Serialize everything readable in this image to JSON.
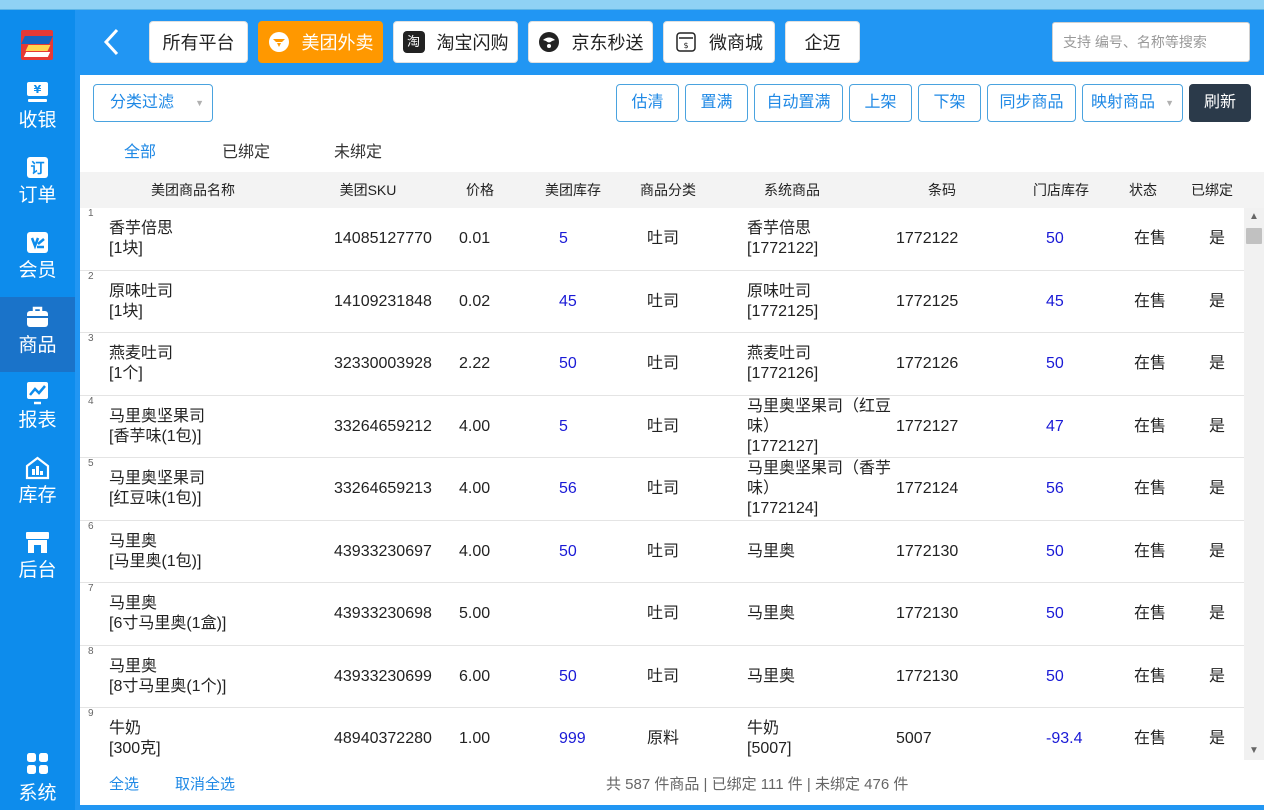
{
  "sidebar": {
    "logo_icon": "brand-logo-icon",
    "items": [
      {
        "label": "收银",
        "icon": "yen-register-icon",
        "active": false
      },
      {
        "label": "订单",
        "icon": "order-icon",
        "active": false
      },
      {
        "label": "会员",
        "icon": "member-card-icon",
        "active": false
      },
      {
        "label": "商品",
        "icon": "briefcase-icon",
        "active": true
      },
      {
        "label": "报表",
        "icon": "chart-icon",
        "active": false
      },
      {
        "label": "库存",
        "icon": "warehouse-icon",
        "active": false
      },
      {
        "label": "后台",
        "icon": "store-icon",
        "active": false
      }
    ],
    "system_label": "系统"
  },
  "header": {
    "platforms": [
      {
        "label": "所有平台",
        "active": false
      },
      {
        "label": "美团外卖",
        "active": true,
        "icon": "meituan-icon"
      },
      {
        "label": "淘宝闪购",
        "active": false,
        "icon": "taobao-icon",
        "icon_text": "淘"
      },
      {
        "label": "京东秒送",
        "active": false,
        "icon": "jd-icon"
      },
      {
        "label": "微商城",
        "active": false,
        "icon": "weishop-icon"
      },
      {
        "label": "企迈",
        "active": false
      }
    ],
    "search_placeholder": "支持 编号、名称等搜索"
  },
  "toolbar": {
    "filter_label": "分类过滤",
    "buttons": [
      "估清",
      "置满",
      "自动置满",
      "上架",
      "下架",
      "同步商品"
    ],
    "map_label": "映射商品",
    "refresh_label": "刷新"
  },
  "tabs": [
    "全部",
    "已绑定",
    "未绑定"
  ],
  "table": {
    "columns": [
      "美团商品名称",
      "美团SKU",
      "价格",
      "美团库存",
      "商品分类",
      "系统商品",
      "条码",
      "门店库存",
      "状态",
      "已绑定"
    ],
    "rows": [
      {
        "num": "1",
        "name": "香芋倍思",
        "spec": "[1块]",
        "sku": "14085127770",
        "price": "0.01",
        "stock": "5",
        "category": "吐司",
        "sys": [
          "香芋倍思",
          "[1772122]"
        ],
        "barcode": "1772122",
        "store_stock": "50",
        "status": "在售",
        "bound": "是"
      },
      {
        "num": "2",
        "name": "原味吐司",
        "spec": "[1块]",
        "sku": "14109231848",
        "price": "0.02",
        "stock": "45",
        "category": "吐司",
        "sys": [
          "原味吐司",
          "[1772125]"
        ],
        "barcode": "1772125",
        "store_stock": "45",
        "status": "在售",
        "bound": "是"
      },
      {
        "num": "3",
        "name": "燕麦吐司",
        "spec": "[1个]",
        "sku": "32330003928",
        "price": "2.22",
        "stock": "50",
        "category": "吐司",
        "sys": [
          "燕麦吐司",
          "[1772126]"
        ],
        "barcode": "1772126",
        "store_stock": "50",
        "status": "在售",
        "bound": "是"
      },
      {
        "num": "4",
        "name": "马里奥坚果司",
        "spec": "[香芋味(1包)]",
        "sku": "33264659212",
        "price": "4.00",
        "stock": "5",
        "category": "吐司",
        "sys": [
          "马里奥坚果司（红豆",
          "味）",
          "[1772127]"
        ],
        "barcode": "1772127",
        "store_stock": "47",
        "status": "在售",
        "bound": "是"
      },
      {
        "num": "5",
        "name": "马里奥坚果司",
        "spec": "[红豆味(1包)]",
        "sku": "33264659213",
        "price": "4.00",
        "stock": "56",
        "category": "吐司",
        "sys": [
          "马里奥坚果司（香芋",
          "味）",
          "[1772124]"
        ],
        "barcode": "1772124",
        "store_stock": "56",
        "status": "在售",
        "bound": "是"
      },
      {
        "num": "6",
        "name": "马里奥",
        "spec": "[马里奥(1包)]",
        "sku": "43933230697",
        "price": "4.00",
        "stock": "50",
        "category": "吐司",
        "sys": [
          "马里奥"
        ],
        "barcode": "1772130",
        "store_stock": "50",
        "status": "在售",
        "bound": "是"
      },
      {
        "num": "7",
        "name": "马里奥",
        "spec": "[6寸马里奥(1盒)]",
        "sku": "43933230698",
        "price": "5.00",
        "stock": "",
        "category": "吐司",
        "sys": [
          "马里奥"
        ],
        "barcode": "1772130",
        "store_stock": "50",
        "status": "在售",
        "bound": "是"
      },
      {
        "num": "8",
        "name": "马里奥",
        "spec": "[8寸马里奥(1个)]",
        "sku": "43933230699",
        "price": "6.00",
        "stock": "50",
        "category": "吐司",
        "sys": [
          "马里奥"
        ],
        "barcode": "1772130",
        "store_stock": "50",
        "status": "在售",
        "bound": "是"
      },
      {
        "num": "9",
        "name": "牛奶",
        "spec": "[300克]",
        "sku": "48940372280",
        "price": "1.00",
        "stock": "999",
        "category": "原料",
        "sys": [
          "牛奶",
          "[5007]"
        ],
        "barcode": "5007",
        "store_stock": "-93.4",
        "status": "在售",
        "bound": "是"
      }
    ]
  },
  "footer": {
    "select_all": "全选",
    "deselect_all": "取消全选",
    "summary": "共 587 件商品 | 已绑定 111 件 | 未绑定 476 件"
  },
  "colors": {
    "sidebar": "#0d8cec",
    "accent_blue": "#1e88e5",
    "active_platform": "#ff9800",
    "refresh": "#2b3a4a"
  }
}
